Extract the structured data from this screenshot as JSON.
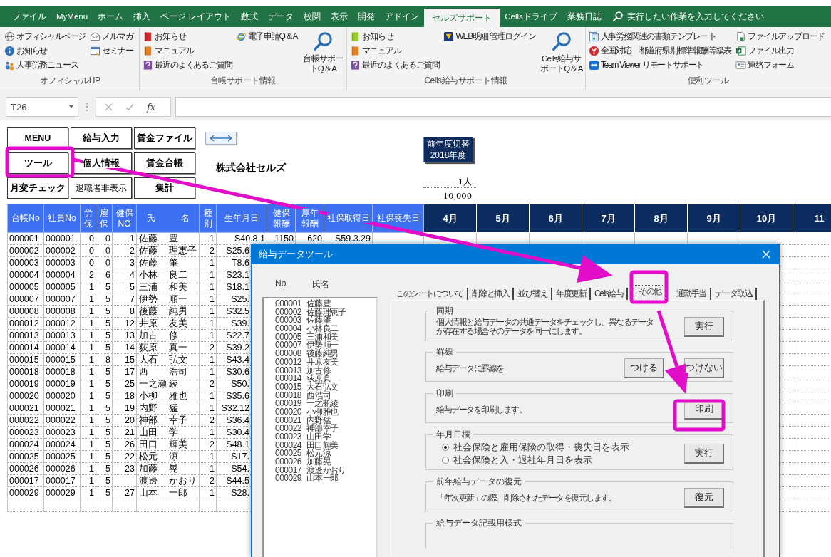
{
  "ribbon": {
    "tabs": [
      {
        "label": "ファイル",
        "selected": false
      },
      {
        "label": "MyMenu",
        "selected": false
      },
      {
        "label": "ホーム",
        "selected": false
      },
      {
        "label": "挿入",
        "selected": false
      },
      {
        "label": "ページ レイアウト",
        "selected": false
      },
      {
        "label": "数式",
        "selected": false
      },
      {
        "label": "データ",
        "selected": false
      },
      {
        "label": "校閲",
        "selected": false
      },
      {
        "label": "表示",
        "selected": false
      },
      {
        "label": "開発",
        "selected": false
      },
      {
        "label": "アドイン",
        "selected": false
      },
      {
        "label": "セルズサポート",
        "selected": true
      },
      {
        "label": "Cellsドライブ",
        "selected": false
      },
      {
        "label": "業務日誌",
        "selected": false
      }
    ],
    "search": {
      "placeholder": "実行したい作業を入力してください"
    },
    "groups": [
      {
        "label": "オフィシャルHP",
        "columns": [
          [
            "オフィシャルページ",
            "お知らせ",
            "人事労務ニュース"
          ],
          [
            "メルマガ",
            "セミナー"
          ]
        ]
      },
      {
        "label": "台帳サポート情報",
        "columns": [
          [
            "お知らせ",
            "マニュアル",
            "最近のよくあるご質問"
          ],
          [
            "電子申請Q＆A"
          ]
        ],
        "large": "台帳サポートQ＆A"
      },
      {
        "label": "Cells給与サポート情報",
        "columns": [
          [
            "お知らせ",
            "マニュアル",
            "最近のよくあるご質問"
          ],
          [
            "WEB明細 管理ログイン"
          ]
        ],
        "large": "Cells給与サポートQ＆A"
      },
      {
        "label": "便利ツール",
        "columns": [
          [
            "人事労務関連の書類テンプレート",
            "全国対応　都道府県別標準報酬等級表",
            "Team Viewer リモートサポート"
          ],
          [
            "ファイルアップロード",
            "ファイル出力",
            "連絡フォーム"
          ]
        ]
      }
    ]
  },
  "formula_bar": {
    "name_box": "T26",
    "function_label": "fx"
  },
  "sheet": {
    "buttons": [
      {
        "label": "MENU",
        "bold": true
      },
      {
        "label": "給与入力",
        "bold": true
      },
      {
        "label": "賃金ファイル",
        "bold": true
      },
      {
        "label": "ツール",
        "bold": true
      },
      {
        "label": "個人情報",
        "bold": true
      },
      {
        "label": "賃金台帳",
        "bold": true
      },
      {
        "label": "月変チェック",
        "bold": true
      },
      {
        "label": "退職者非表示",
        "bold": false
      },
      {
        "label": "集計",
        "bold": true
      }
    ],
    "company": "株式会社セルズ",
    "year_button": [
      "前年度切替",
      "2018年度"
    ],
    "count": "1人",
    "amount": "10,000",
    "columns": [
      "台帳No",
      "社員No",
      "労保",
      "雇保",
      "健保NO",
      "氏　　　名",
      "種別",
      "生年月日",
      "健保報酬",
      "厚年報酬",
      "社保取得日",
      "社保喪失日",
      "4月",
      "5月",
      "6月",
      "7月",
      "8月",
      "9月",
      "10月",
      "11"
    ],
    "rows": [
      {
        "ledger_no": "000001",
        "employee_no": "000001",
        "labor": "0",
        "employment": "0",
        "health_no": "1",
        "family": "佐藤",
        "given": "豊",
        "type": "1",
        "birth": "S40.8.1",
        "health_pay": "1150",
        "pension_pay": "620",
        "acquired": "S59.3.29"
      },
      {
        "ledger_no": "000002",
        "employee_no": "000002",
        "labor": "0",
        "employment": "0",
        "health_no": "2",
        "family": "佐藤",
        "given": "理恵子",
        "type": "2",
        "birth": "S25.6"
      },
      {
        "ledger_no": "000003",
        "employee_no": "000003",
        "labor": "0",
        "employment": "0",
        "health_no": "3",
        "family": "佐藤",
        "given": "肇",
        "type": "1",
        "birth": "T8.6"
      },
      {
        "ledger_no": "000004",
        "employee_no": "000004",
        "labor": "2",
        "employment": "6",
        "health_no": "4",
        "family": "小林",
        "given": "良二",
        "type": "1",
        "birth": "S23.1"
      },
      {
        "ledger_no": "000005",
        "employee_no": "000005",
        "labor": "1",
        "employment": "5",
        "health_no": "5",
        "family": "三浦",
        "given": "和美",
        "type": "1",
        "birth": "S18.1"
      },
      {
        "ledger_no": "000007",
        "employee_no": "000007",
        "labor": "1",
        "employment": "5",
        "health_no": "7",
        "family": "伊勢",
        "given": "順一",
        "type": "1",
        "birth": "S25."
      },
      {
        "ledger_no": "000008",
        "employee_no": "000008",
        "labor": "1",
        "employment": "5",
        "health_no": "8",
        "family": "後藤",
        "given": "純男",
        "type": "1",
        "birth": "S32.5"
      },
      {
        "ledger_no": "000012",
        "employee_no": "000012",
        "labor": "1",
        "employment": "5",
        "health_no": "12",
        "family": "井原",
        "given": "友美",
        "type": "1",
        "birth": "S39."
      },
      {
        "ledger_no": "000013",
        "employee_no": "000013",
        "labor": "1",
        "employment": "5",
        "health_no": "13",
        "family": "加古",
        "given": "修",
        "type": "1",
        "birth": "S22.7"
      },
      {
        "ledger_no": "000014",
        "employee_no": "000014",
        "labor": "1",
        "employment": "5",
        "health_no": "14",
        "family": "荻原",
        "given": "真一",
        "type": "2",
        "birth": "S39.2"
      },
      {
        "ledger_no": "000015",
        "employee_no": "000015",
        "labor": "1",
        "employment": "8",
        "health_no": "15",
        "family": "大石",
        "given": "弘文",
        "type": "1",
        "birth": "S43.4"
      },
      {
        "ledger_no": "000018",
        "employee_no": "000018",
        "labor": "1",
        "employment": "5",
        "health_no": "17",
        "family": "西",
        "given": "浩司",
        "type": "1",
        "birth": "S30.6"
      },
      {
        "ledger_no": "000019",
        "employee_no": "000019",
        "labor": "1",
        "employment": "5",
        "health_no": "25",
        "family": "一之瀬",
        "given": "綾",
        "type": "2",
        "birth": "S50."
      },
      {
        "ledger_no": "000020",
        "employee_no": "000020",
        "labor": "1",
        "employment": "5",
        "health_no": "18",
        "family": "小柳",
        "given": "雅也",
        "type": "1",
        "birth": "S35.6"
      },
      {
        "ledger_no": "000021",
        "employee_no": "000021",
        "labor": "1",
        "employment": "5",
        "health_no": "19",
        "family": "内野",
        "given": "猛",
        "type": "1",
        "birth": "S32.12"
      },
      {
        "ledger_no": "000022",
        "employee_no": "000022",
        "labor": "1",
        "employment": "5",
        "health_no": "20",
        "family": "神部",
        "given": "幸子",
        "type": "2",
        "birth": "S36.4"
      },
      {
        "ledger_no": "000023",
        "employee_no": "000023",
        "labor": "1",
        "employment": "5",
        "health_no": "21",
        "family": "山田",
        "given": "学",
        "type": "1",
        "birth": "S30.4"
      },
      {
        "ledger_no": "000024",
        "employee_no": "000024",
        "labor": "1",
        "employment": "5",
        "health_no": "26",
        "family": "田口",
        "given": "輝美",
        "type": "2",
        "birth": "S48.1"
      },
      {
        "ledger_no": "000025",
        "employee_no": "000025",
        "labor": "1",
        "employment": "5",
        "health_no": "22",
        "family": "松元",
        "given": "涼",
        "type": "1",
        "birth": "S17."
      },
      {
        "ledger_no": "000026",
        "employee_no": "000026",
        "labor": "1",
        "employment": "5",
        "health_no": "23",
        "family": "加藤",
        "given": "晃",
        "type": "1",
        "birth": "S54."
      },
      {
        "ledger_no": "000017",
        "employee_no": "000017",
        "labor": "1",
        "employment": "5",
        "family": "渡邊",
        "given": "かおり",
        "type": "2",
        "birth": "S44.5"
      },
      {
        "ledger_no": "000029",
        "employee_no": "000029",
        "labor": "1",
        "employment": "5",
        "health_no": "27",
        "family": "山本",
        "given": "一郎",
        "type": "1",
        "birth": "S28."
      }
    ]
  },
  "dialog": {
    "title": "給与データツール",
    "list_header": {
      "no": "No",
      "name": "氏名"
    },
    "list": [
      {
        "no": "000001",
        "name": "佐藤 豊"
      },
      {
        "no": "000002",
        "name": "佐藤 理恵子"
      },
      {
        "no": "000003",
        "name": "佐藤 肇"
      },
      {
        "no": "000004",
        "name": "小林 良二"
      },
      {
        "no": "000005",
        "name": "三浦 和美"
      },
      {
        "no": "000007",
        "name": "伊勢 順一"
      },
      {
        "no": "000008",
        "name": "後藤 純男"
      },
      {
        "no": "000012",
        "name": "井原 友美"
      },
      {
        "no": "000013",
        "name": "加古 修"
      },
      {
        "no": "000014",
        "name": "荻原 真一"
      },
      {
        "no": "000015",
        "name": "大石 弘文"
      },
      {
        "no": "000018",
        "name": "西 浩司"
      },
      {
        "no": "000019",
        "name": "一之瀬 綾"
      },
      {
        "no": "000020",
        "name": "小柳 雅也"
      },
      {
        "no": "000021",
        "name": "内野 猛"
      },
      {
        "no": "000022",
        "name": "神部 幸子"
      },
      {
        "no": "000023",
        "name": "山田 学"
      },
      {
        "no": "000024",
        "name": "田口 輝美"
      },
      {
        "no": "000025",
        "name": "松元 涼"
      },
      {
        "no": "000026",
        "name": "加藤 晃"
      },
      {
        "no": "000017",
        "name": "渡邊 かおり"
      },
      {
        "no": "000029",
        "name": "山本 一郎"
      }
    ],
    "tabs": [
      {
        "label": "このシートについて",
        "selected": false
      },
      {
        "label": "削除と挿入",
        "selected": false
      },
      {
        "label": "並び替え",
        "selected": false
      },
      {
        "label": "年度更新",
        "selected": false
      },
      {
        "label": "Cells給与",
        "selected": false
      },
      {
        "label": "その他",
        "selected": true
      },
      {
        "label": "通勤手当",
        "selected": false
      },
      {
        "label": "データ取込",
        "selected": false
      }
    ],
    "sections": [
      {
        "title": "同期",
        "lines": [
          "個人情報と給与データの共通データをチェックし、異なるデータ",
          "が存在する場合そのデータを同一にします。"
        ],
        "buttons": [
          "実行"
        ]
      },
      {
        "title": "罫線",
        "lines": [
          "給与データに罫線を"
        ],
        "buttons": [
          "つける",
          "つけない"
        ]
      },
      {
        "title": "印刷",
        "lines": [
          "給与データを印刷します。"
        ],
        "buttons": [
          "印刷"
        ]
      },
      {
        "title": "年月日欄",
        "radios": [
          {
            "label": "社会保険と雇用保険の取得・喪失日を表示",
            "selected": true
          },
          {
            "label": "社会保険と入・退社年月日を表示",
            "selected": false
          }
        ],
        "buttons": [
          "実行"
        ]
      },
      {
        "title": "前年給与データの復元",
        "lines": [
          "「年次更新」の際、削除されたデータを復元します。"
        ],
        "buttons": [
          "復元"
        ]
      },
      {
        "title": "給与データ記載用様式"
      }
    ]
  }
}
